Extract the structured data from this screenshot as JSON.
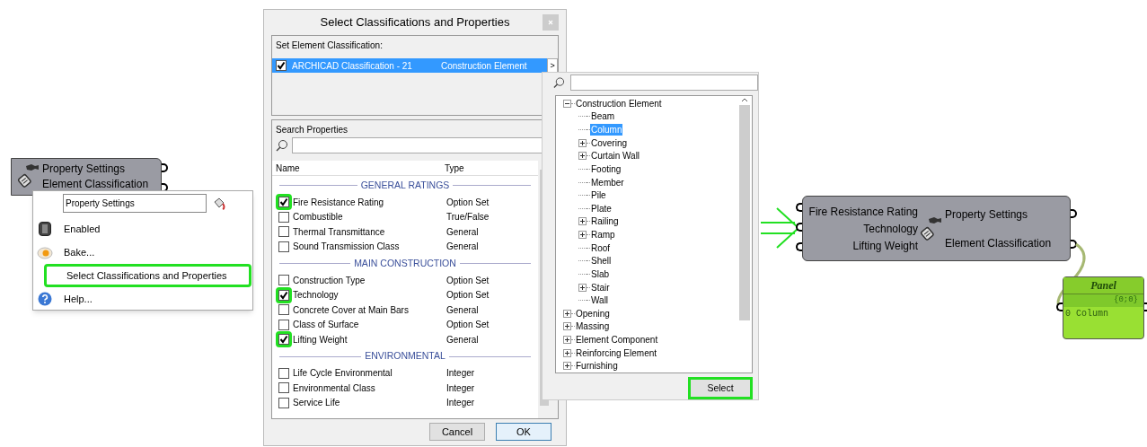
{
  "left_component": {
    "outputs": [
      "Property Settings",
      "Element Classification"
    ]
  },
  "context_menu": {
    "name_field": "Property Settings",
    "items": [
      {
        "label": "Enabled",
        "kind": "toggle",
        "highlighted": false
      },
      {
        "label": "Bake...",
        "kind": "bake",
        "highlighted": false
      },
      {
        "label": "Select Classifications and Properties",
        "kind": "plain",
        "highlighted": true
      },
      {
        "label": "Help...",
        "kind": "help",
        "highlighted": false
      }
    ]
  },
  "dialog": {
    "title": "Select Classifications and Properties",
    "classification_label": "Set Element Classification:",
    "classifications": [
      {
        "name": "ARCHICAD Classification - 21",
        "value": "Construction Element",
        "checked": true,
        "selected": true,
        "expand_button": ">"
      }
    ],
    "search_label": "Search Properties",
    "columns": [
      "Name",
      "Type"
    ],
    "groups": [
      {
        "title": "GENERAL RATINGS",
        "properties": [
          {
            "name": "Fire Resistance Rating",
            "type": "Option Set",
            "checked": true,
            "highlighted": true
          },
          {
            "name": "Combustible",
            "type": "True/False",
            "checked": false,
            "highlighted": false
          },
          {
            "name": "Thermal Transmittance",
            "type": "General",
            "checked": false,
            "highlighted": false
          },
          {
            "name": "Sound Transmission Class",
            "type": "General",
            "checked": false,
            "highlighted": false
          }
        ]
      },
      {
        "title": "MAIN CONSTRUCTION",
        "properties": [
          {
            "name": "Construction Type",
            "type": "Option Set",
            "checked": false,
            "highlighted": false
          },
          {
            "name": "Technology",
            "type": "Option Set",
            "checked": true,
            "highlighted": true
          },
          {
            "name": "Concrete Cover at Main Bars",
            "type": "General",
            "checked": false,
            "highlighted": false
          },
          {
            "name": "Class of Surface",
            "type": "Option Set",
            "checked": false,
            "highlighted": false
          },
          {
            "name": "Lifting Weight",
            "type": "General",
            "checked": true,
            "highlighted": true
          }
        ]
      },
      {
        "title": "ENVIRONMENTAL",
        "properties": [
          {
            "name": "Life Cycle Environmental",
            "type": "Integer",
            "checked": false,
            "highlighted": false
          },
          {
            "name": "Environmental Class",
            "type": "Integer",
            "checked": false,
            "highlighted": false
          },
          {
            "name": "Service Life",
            "type": "Integer",
            "checked": false,
            "highlighted": false
          }
        ]
      }
    ],
    "buttons": [
      "Cancel",
      "OK"
    ]
  },
  "tree_popup": {
    "nodes": [
      {
        "label": "Construction Element",
        "expanded": true,
        "selected": false,
        "children": [
          {
            "label": "Beam",
            "selected": false
          },
          {
            "label": "Column",
            "selected": true
          },
          {
            "label": "Covering",
            "expanded": false,
            "selected": false
          },
          {
            "label": "Curtain Wall",
            "expanded": false,
            "selected": false
          },
          {
            "label": "Footing",
            "selected": false
          },
          {
            "label": "Member",
            "selected": false
          },
          {
            "label": "Pile",
            "selected": false
          },
          {
            "label": "Plate",
            "selected": false
          },
          {
            "label": "Railing",
            "expanded": false,
            "selected": false
          },
          {
            "label": "Ramp",
            "expanded": false,
            "selected": false
          },
          {
            "label": "Roof",
            "selected": false
          },
          {
            "label": "Shell",
            "selected": false
          },
          {
            "label": "Slab",
            "selected": false
          },
          {
            "label": "Stair",
            "expanded": false,
            "selected": false
          },
          {
            "label": "Wall",
            "selected": false
          }
        ]
      },
      {
        "label": "Opening",
        "expanded": false,
        "selected": false
      },
      {
        "label": "Massing",
        "expanded": false,
        "selected": false
      },
      {
        "label": "Element Component",
        "expanded": false,
        "selected": false
      },
      {
        "label": "Reinforcing Element",
        "expanded": false,
        "selected": false
      },
      {
        "label": "Furnishing",
        "expanded": false,
        "selected": false
      }
    ],
    "select_button": {
      "label": "Select",
      "highlighted": true
    }
  },
  "right_component": {
    "inputs": [
      "Fire Resistance Rating",
      "Technology",
      "Lifting Weight"
    ],
    "outputs": [
      "Property Settings",
      "Element Classification"
    ]
  },
  "panel": {
    "title": "Panel",
    "path": "{0;0}",
    "items": [
      {
        "index": "0",
        "value": "Column"
      }
    ]
  }
}
